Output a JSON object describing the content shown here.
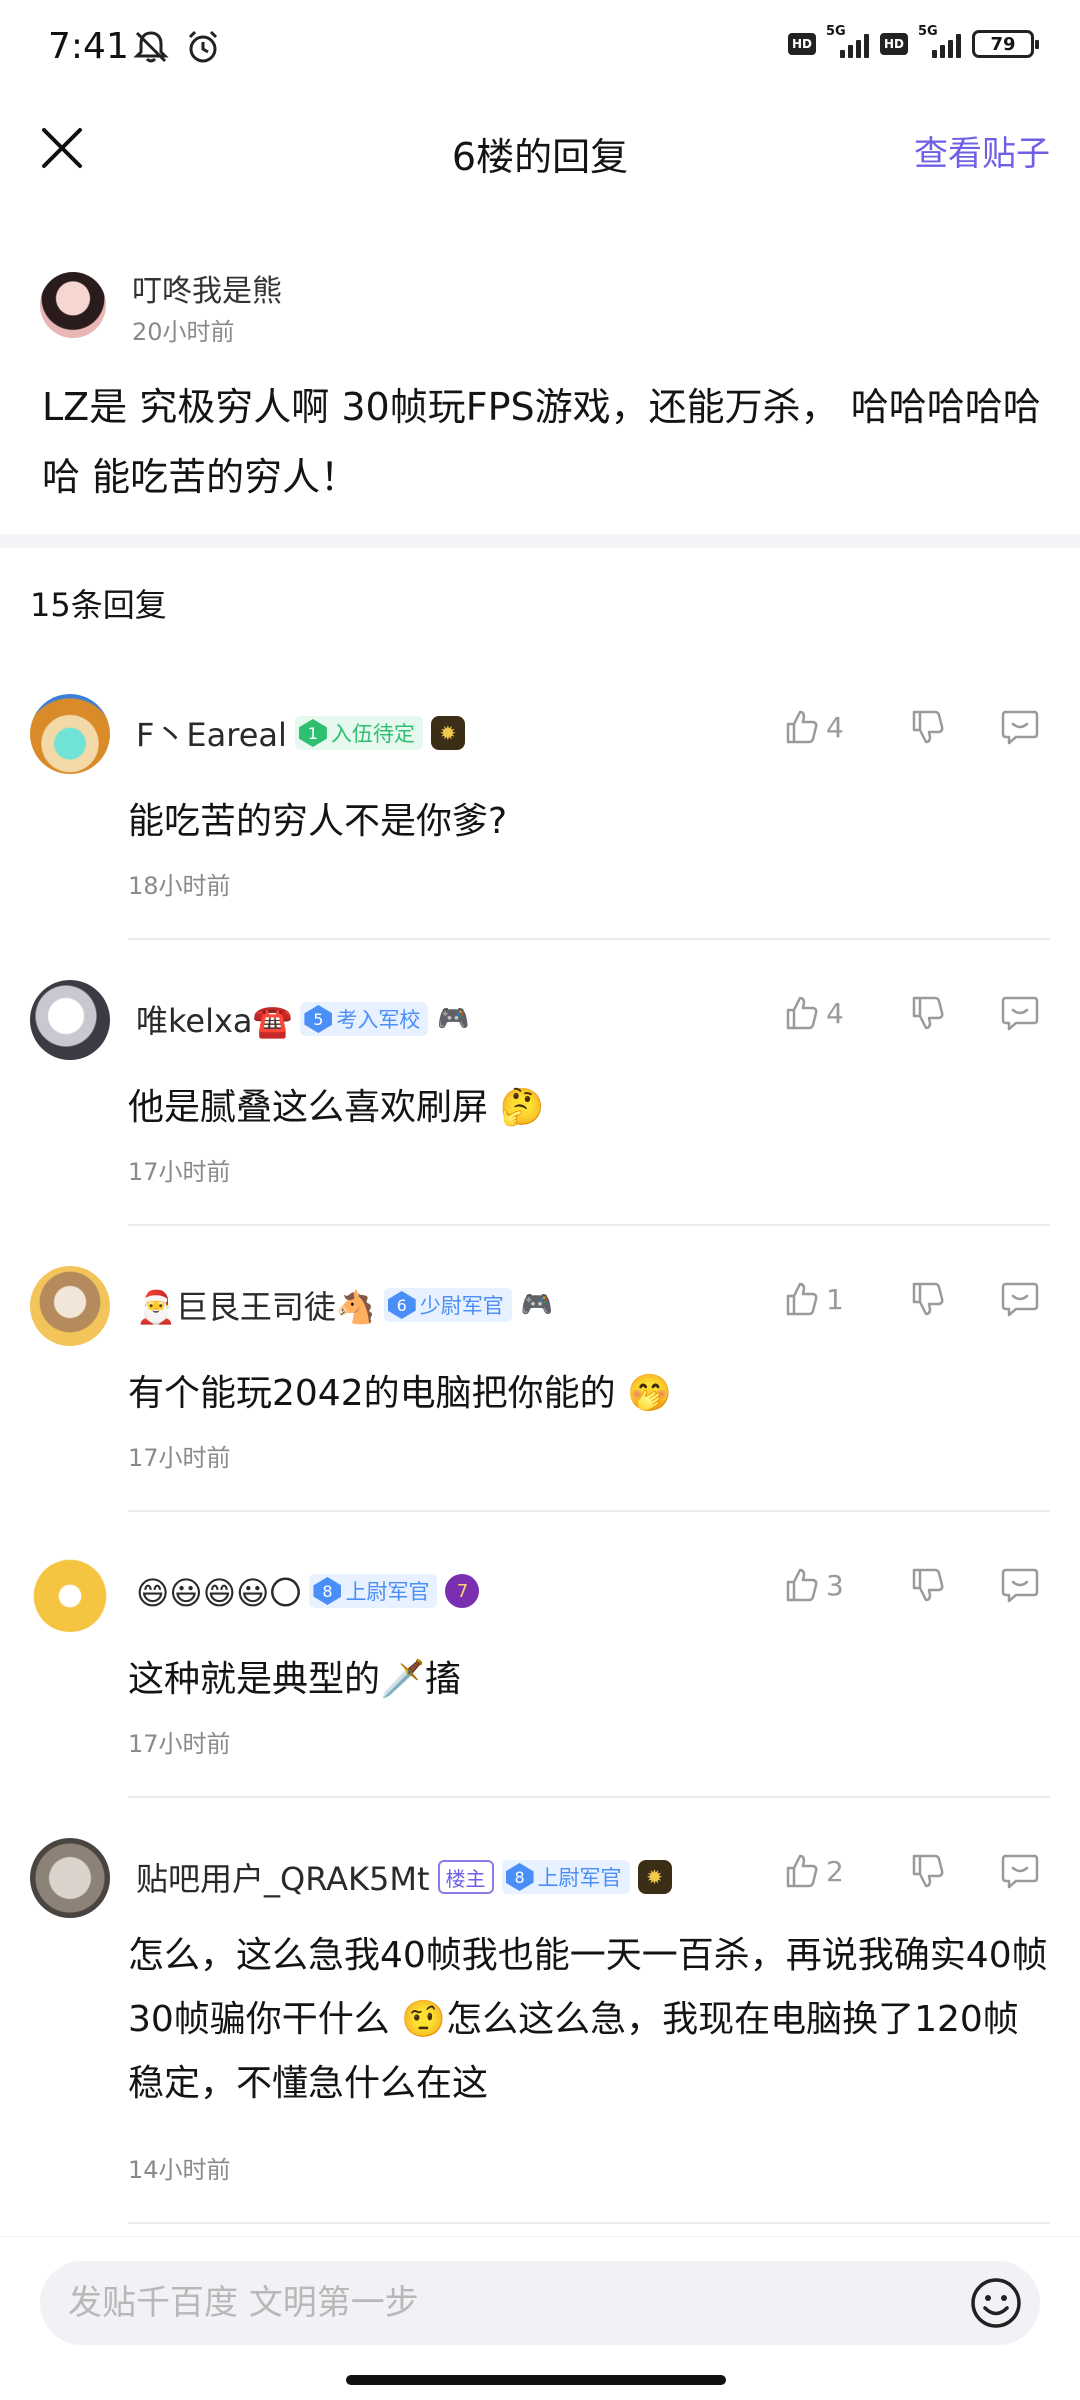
{
  "status_bar": {
    "time": "7:41",
    "network_label_1": "5G",
    "network_label_2": "5G",
    "hd_label_1": "HD",
    "hd_label_2": "HD",
    "battery": "79"
  },
  "nav": {
    "title": "6楼的回复",
    "view_post": "查看贴子"
  },
  "post": {
    "author": "叮咚我是熊",
    "time": "20小时前",
    "content": "LZ是 究极穷人啊 30帧玩FPS游戏，还能万杀， 哈哈哈哈哈哈 能吃苦的穷人！"
  },
  "reply_count": "15条回复",
  "replies": [
    {
      "name": "F丶Eareal",
      "level": "1",
      "level_title": "入伍待定",
      "level_color": "#2fbf71",
      "content": "能吃苦的穷人不是你爹?",
      "time": "18小时前",
      "likes": "4"
    },
    {
      "name": "唯kelxa☎️",
      "level": "5",
      "level_title": "考入军校",
      "level_color": "#4a8ff7",
      "content": "他是腻叠这么喜欢刷屏 🤔",
      "time": "17小时前",
      "likes": "4"
    },
    {
      "name": "🎅巨艮王司徒🐴",
      "level": "6",
      "level_title": "少尉军官",
      "level_color": "#4a8ff7",
      "content": "有个能玩2042的电脑把你能的 🤭",
      "time": "17小时前",
      "likes": "1"
    },
    {
      "name": "😄😃😄😃〇",
      "level": "8",
      "level_title": "上尉军官",
      "level_color": "#4a8ff7",
      "content": "这种就是典型的🗡️搐",
      "time": "17小时前",
      "likes": "3"
    },
    {
      "name": "贴吧用户_QRAK5Mt",
      "lz_tag": "楼主",
      "level": "8",
      "level_title": "上尉军官",
      "level_color": "#4a8ff7",
      "content": "怎么，这么急我40帧我也能一天一百杀，再说我确实40帧30帧骗你干什么 🤨怎么这么急，我现在电脑换了120帧稳定，不懂急什么在这",
      "time": "14小时前",
      "likes": "2"
    }
  ],
  "input": {
    "placeholder": "发贴千百度 文明第一步"
  },
  "colors": {
    "accent": "#6e5fe6",
    "muted": "#8a8a8a",
    "level_green": "#2fbf71",
    "level_blue": "#4a8ff7"
  }
}
